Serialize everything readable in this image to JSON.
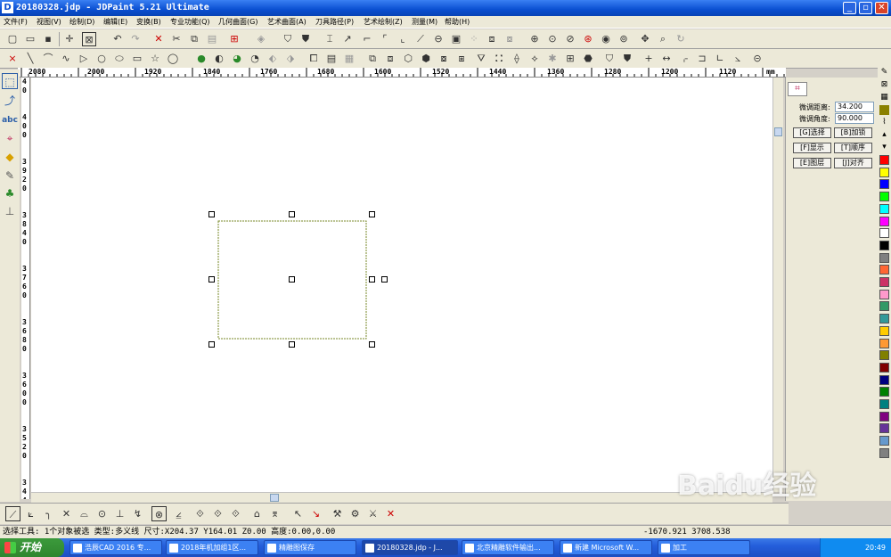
{
  "window": {
    "title": "20180328.jdp - JDPaint 5.21 Ultimate",
    "controls": {
      "minimize": "_",
      "maximize": "▫",
      "close": "✕"
    }
  },
  "menu": [
    "文件(F)",
    "视图(V)",
    "绘制(D)",
    "编辑(E)",
    "变换(B)",
    "专业功能(Q)",
    "几何曲面(G)",
    "艺术曲面(A)",
    "刀具路径(P)",
    "艺术绘制(Z)",
    "测量(M)",
    "帮助(H)"
  ],
  "ruler_h_labels": [
    "2080",
    "2000",
    "1920",
    "1840",
    "1760",
    "1680",
    "1600",
    "1520",
    "1440",
    "1360",
    "1280",
    "1200",
    "1120",
    "mm"
  ],
  "ruler_v_groups": [
    "40",
    "400",
    "3920",
    "3840",
    "3760",
    "3680",
    "3600",
    "3520",
    "3440",
    "4"
  ],
  "panel": {
    "fine_dist_label": "微调距离:",
    "fine_dist_value": "34.200",
    "fine_angle_label": "微调角度:",
    "fine_angle_value": "90.000",
    "buttons": [
      "[G]选择",
      "[B]加锁",
      "[F]显示",
      "[T]顺序",
      "[E]图层",
      "[J]对齐"
    ]
  },
  "colors": [
    "#ff0000",
    "#ffff00",
    "#0000ff",
    "#00ff00",
    "#00ffff",
    "#ff00ff",
    "#ffffff",
    "#000000",
    "#808080",
    "#ff6633",
    "#cc3366",
    "#ff99cc",
    "#339966",
    "#339999",
    "#ffcc00",
    "#ff9933",
    "#808000",
    "#800000",
    "#000080",
    "#008000",
    "#008080",
    "#800080",
    "#663399",
    "#6699cc",
    "#808080"
  ],
  "status": {
    "text": "选择工具: 1个对象被选 类型:多义线 尺寸:X204.37 Y164.01 Z0.00 高度:0.00,0.00",
    "coords": "-1670.921  3708.538"
  },
  "taskbar": {
    "start": "开始",
    "tasks": [
      {
        "label": "浩辰CAD 2016 专..."
      },
      {
        "label": "2018年机加组1区..."
      },
      {
        "label": "精雕图保存"
      },
      {
        "label": "20180328.jdp - J..."
      },
      {
        "label": "北京精雕软件输出..."
      },
      {
        "label": "新建 Microsoft W..."
      },
      {
        "label": "加工"
      }
    ],
    "clock": "20:49"
  },
  "watermark": "Baidu经验"
}
